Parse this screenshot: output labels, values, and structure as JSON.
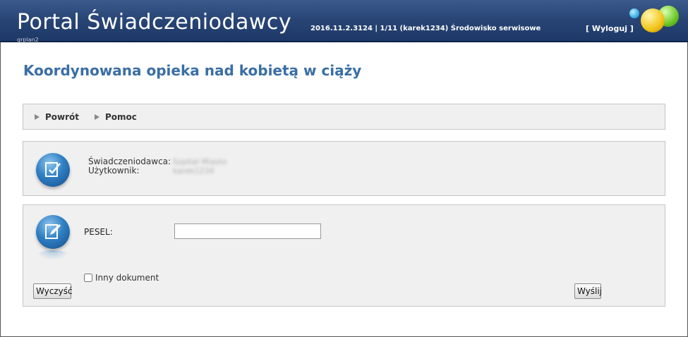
{
  "header": {
    "app_title": "Portal Świadczeniodawcy",
    "version_info": "2016.11.2.3124 | 1/11 (karek1234) Środowisko serwisowe",
    "logout_label": "[ Wyloguj ]",
    "subtag": "grplan2"
  },
  "page": {
    "title": "Koordynowana opieka nad kobietą w ciąży"
  },
  "nav": {
    "back_label": "Powrót",
    "help_label": "Pomoc"
  },
  "info": {
    "provider_label": "Świadczeniodawca:",
    "user_label": "Użytkownik:",
    "provider_value": "Szpital Miasto",
    "user_value": "karek1234"
  },
  "form": {
    "pesel_label": "PESEL:",
    "pesel_value": "",
    "other_document_label": "Inny dokument",
    "other_document_checked": false,
    "clear_label": "Wyczyść",
    "send_label": "Wyślij"
  },
  "colors": {
    "header_bg": "#294677",
    "title_color": "#3a6ea5",
    "panel_bg": "#f0f0f0"
  },
  "icons": [
    "arrow-right-icon",
    "edit-document-icon",
    "balls-logo-icon"
  ]
}
